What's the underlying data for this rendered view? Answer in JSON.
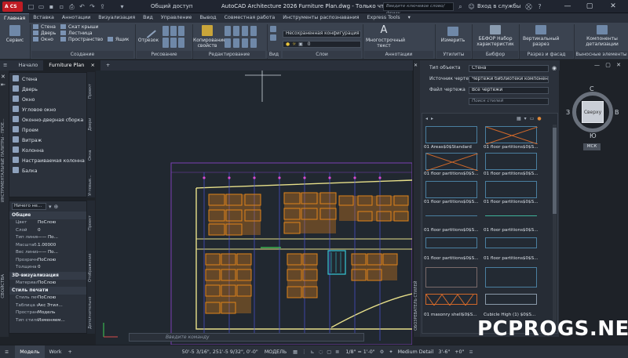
{
  "titlebar": {
    "app_label": "A CS",
    "share": "Общий доступ",
    "title": "AutoCAD Architecture 2026   Furniture Plan.dwg - Только чтение",
    "search_placeholder": "Введите ключевое слово/фразу",
    "login": "Вход в службы",
    "min": "—",
    "max": "▢",
    "close": "✕"
  },
  "ribbon_tabs": [
    "Главная",
    "Вставка",
    "Аннотации",
    "Визуализация",
    "Вид",
    "Управление",
    "Вывод",
    "Совместная работа",
    "Инструменты распознавания",
    "Express Tools"
  ],
  "ribbon": {
    "service": "Сервис",
    "build_items": [
      "Стена",
      "Дверь",
      "Окно",
      "Скат крыши",
      "Лестница",
      "Пространство",
      "Ящик"
    ],
    "build_label": "Создание",
    "otrezok": "Отрезок",
    "draw_label": "Рисование",
    "copy_label": "Копирование свойств",
    "edit_label": "Редактирование",
    "config_value": "Несохраненная конфигурация сл",
    "layer_value": "0",
    "view_label": "Вид",
    "layers_label": "Слои",
    "mtext": "Многострочный текст",
    "annot_label": "Аннотации",
    "measure": "Измерить",
    "util_label": "Утилиты",
    "bibfor": "ББФОР Набор характеристик",
    "bibfor_label": "Бибфор",
    "vertical": "Вертикальный разрез",
    "section_label": "Разрез и фасад",
    "components": "Компоненты детализации",
    "callouts_label": "Выносные элементы"
  },
  "doc_tabs": [
    "Начало",
    "Furniture Plan",
    "+"
  ],
  "palette": {
    "items": [
      "Стена",
      "Дверь",
      "Окно",
      "Угловое окно",
      "Оконно-дверная сборка",
      "Проем",
      "Витраж",
      "Колонна",
      "Настраиваемая колонна",
      "Балка"
    ],
    "tabs": [
      "Проект",
      "Двери",
      "Окна",
      "Угловые..."
    ],
    "side_title": "ИНСТРУМЕНТАЛЬНЫЕ ПАЛИТРЫ - ПРОЕ..."
  },
  "props": {
    "selector": "Ничего не...",
    "general": "Общие",
    "rows": [
      [
        "Цвет",
        "ПоСлою"
      ],
      [
        "Слой",
        "0"
      ],
      [
        "Тип линий",
        "—— По..."
      ],
      [
        "Масштаб...",
        "1.00000"
      ],
      [
        "Вес линий",
        "—— По..."
      ],
      [
        "Прозрачн...",
        "ПоСлою"
      ],
      [
        "Толщина",
        "0"
      ]
    ],
    "viz": "3D-визуализация",
    "material": [
      "Материал",
      "ПоСлою"
    ],
    "plot": "Стиль печати",
    "plot_rows": [
      [
        "Стиль печ...",
        "ПоСлою"
      ],
      [
        "Таблица с...",
        "Акс Этил..."
      ],
      [
        "Простран...",
        "Модель"
      ],
      [
        "Тип стиля...",
        "Изменяем..."
      ]
    ],
    "tabs": [
      "Проект",
      "Отображение",
      "Дополнительно"
    ],
    "side_title": "СВОЙСТВА"
  },
  "browser": {
    "type_label": "Тип объекта",
    "type_value": "Стена",
    "source_label": "Источник чертежа",
    "source_value": "Чертежи библиотеки компонен...",
    "file_label": "Файл чертежа",
    "file_value": "Все чертежи",
    "search_placeholder": "Поиск стилей",
    "side_title": "ОБОЗРЕВАТЕЛЬ СТИЛЕЙ",
    "items": [
      "01 Areas$0$Standard",
      "01 floor partitions$0$S...",
      "01 floor partitions$0$S...",
      "01 floor partitions$0$S...",
      "01 floor partitions$0$S...",
      "01 floor partitions$0$S...",
      "01 floor partitions$0$S...",
      "01 floor partitions$0$S...",
      "01 floor partitions$0$S...",
      "01 floor partitions$0$S...",
      "01 masonry shell$0$S...",
      "Cubicle High (1) $0$S..."
    ]
  },
  "viewcube": {
    "north": "С",
    "south": "Ю",
    "west": "З",
    "east": "В",
    "face": "Сверху",
    "wcs": "МСК"
  },
  "command": {
    "placeholder": "Введите команду"
  },
  "status": {
    "model_tab": "Модель",
    "work_tab": "Work",
    "coords": "50'-5 3/16\", 251'-5 9/32\", 0'-0\"",
    "mode": "МОДЕЛЬ",
    "scale": "1/8\" = 1'-0\"",
    "detail": "Medium Detail",
    "elev": "3'-6\"",
    "level": "+0\""
  },
  "watermark": "PCPROGS.NET"
}
